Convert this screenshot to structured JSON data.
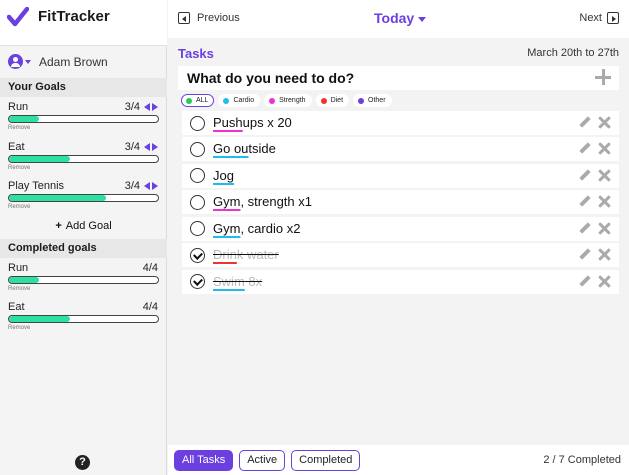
{
  "app": {
    "name": "FitTracker"
  },
  "user": {
    "name": "Adam Brown"
  },
  "sidebar": {
    "your_goals_heading": "Your Goals",
    "goals": [
      {
        "name": "Run",
        "count": "3/4",
        "progress": 0.2,
        "remove": "Remove"
      },
      {
        "name": "Eat",
        "count": "3/4",
        "progress": 0.41,
        "remove": "Remove"
      },
      {
        "name": "Play Tennis",
        "count": "3/4",
        "progress": 0.65,
        "remove": "Remove"
      }
    ],
    "add_goal_label": "Add Goal",
    "completed_heading": "Completed goals",
    "completed": [
      {
        "name": "Run",
        "count": "4/4",
        "progress": 0.2,
        "remove": "Remove"
      },
      {
        "name": "Eat",
        "count": "4/4",
        "progress": 0.41,
        "remove": "Remove"
      }
    ],
    "help_label": "?"
  },
  "header": {
    "previous_label": "Previous",
    "today_label": "Today",
    "next_label": "Next"
  },
  "tasks": {
    "title": "Tasks",
    "date_range": "March 20th to 27th",
    "new_task_placeholder": "What do you need to do?",
    "filters": [
      {
        "label": "ALL",
        "color": "#22cc55",
        "active": true
      },
      {
        "label": "Cardio",
        "color": "#22bbee"
      },
      {
        "label": "Strength",
        "color": "#ee33cc"
      },
      {
        "label": "Diet",
        "color": "#ee3333"
      },
      {
        "label": "Other",
        "color": "#6b3fe0"
      }
    ],
    "items": [
      {
        "tag": "Push",
        "rest": "ups x 20",
        "tag_color": "#ee33cc",
        "done": false
      },
      {
        "tag": "Go ou",
        "rest": "tside",
        "tag_color": "#22bbee",
        "done": false
      },
      {
        "tag": "Jog",
        "rest": "",
        "tag_color": "#22bbee",
        "done": false
      },
      {
        "tag": "Gym",
        "rest": ", strength x1",
        "tag_color": "#ee33cc",
        "done": false
      },
      {
        "tag": "Gym",
        "rest": ", cardio x2",
        "tag_color": "#22bbee",
        "done": false
      },
      {
        "tag": "Drin",
        "rest": "k water",
        "tag_color": "#ee3333",
        "done": true
      },
      {
        "tag": "Swim",
        "rest": " 8x",
        "tag_color": "#22bbee",
        "done": true
      }
    ]
  },
  "footer": {
    "tabs": [
      {
        "label": "All Tasks",
        "active": true
      },
      {
        "label": "Active"
      },
      {
        "label": "Completed"
      }
    ],
    "completed_count": "2 / 7 Completed"
  },
  "colors": {
    "accent": "#6b3fe0",
    "progress": "#2de0a0"
  }
}
